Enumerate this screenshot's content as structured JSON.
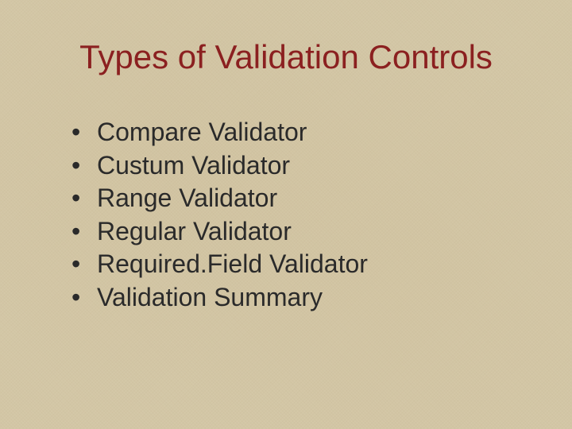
{
  "title": "Types of Validation Controls",
  "bullets": [
    "Compare Validator",
    "Custum Validator",
    "Range Validator",
    "Regular Validator",
    "Required.Field Validator",
    "Validation Summary"
  ]
}
